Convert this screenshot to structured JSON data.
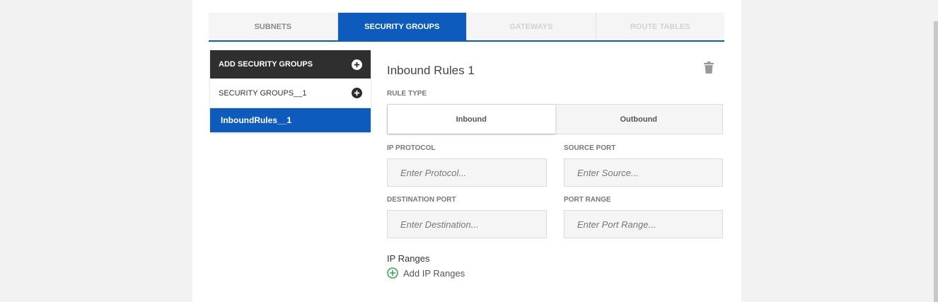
{
  "tabs": [
    {
      "label": "SUBNETS",
      "state": "normal"
    },
    {
      "label": "SECURITY GROUPS",
      "state": "active"
    },
    {
      "label": "GATEWAYS",
      "state": "disabled"
    },
    {
      "label": "ROUTE TABLES",
      "state": "disabled"
    }
  ],
  "sidebar": {
    "header_label": "ADD SECURITY GROUPS",
    "items": [
      {
        "label": "SECURITY GROUPS__1"
      },
      {
        "label": "InboundRules__1"
      }
    ]
  },
  "panel": {
    "title": "Inbound Rules 1",
    "rule_type_label": "RULE TYPE",
    "rule_type_options": [
      "Inbound",
      "Outbound"
    ],
    "rule_type_selected": "Inbound",
    "ip_protocol": {
      "label": "IP PROTOCOL",
      "placeholder": "Enter Protocol...",
      "value": ""
    },
    "source_port": {
      "label": "SOURCE PORT",
      "placeholder": "Enter Source...",
      "value": ""
    },
    "destination_port": {
      "label": "DESTINATION PORT",
      "placeholder": "Enter Destination...",
      "value": ""
    },
    "port_range": {
      "label": "PORT RANGE",
      "placeholder": "Enter Port Range...",
      "value": ""
    },
    "ip_ranges_label": "IP Ranges",
    "add_ip_ranges_label": "Add IP Ranges"
  },
  "icons": {
    "add_group": "plus-circle-icon",
    "add_rule": "plus-circle-icon",
    "delete": "trash-icon",
    "add_ip": "plus-circle-outline-icon"
  },
  "colors": {
    "accent": "#0d5bbd",
    "dark_header": "#2f2f2f",
    "add_green": "#2eaa4a"
  }
}
